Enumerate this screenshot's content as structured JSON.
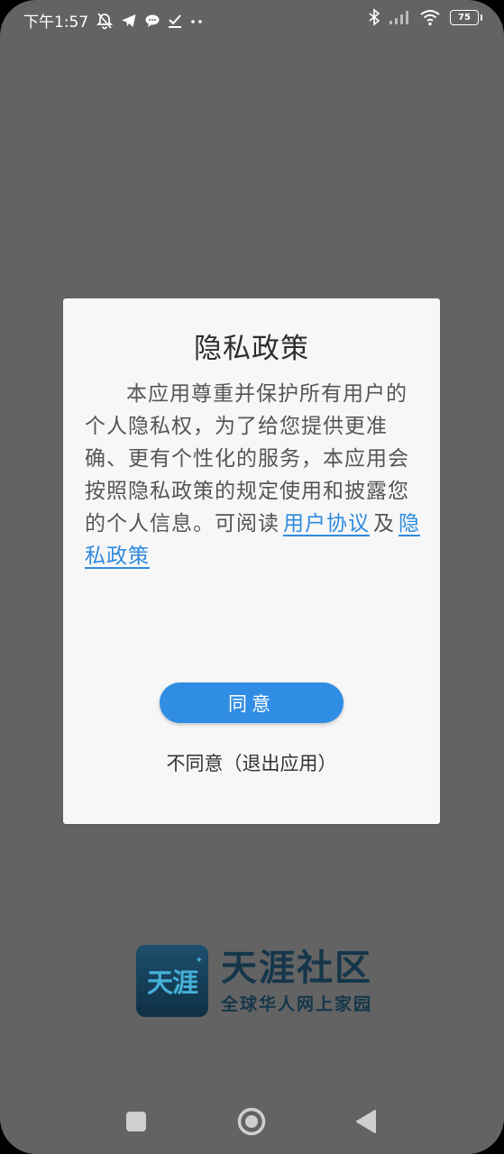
{
  "status_bar": {
    "time": "下午1:57",
    "battery_level": "75"
  },
  "dialog": {
    "title": "隐私政策",
    "body_text": "本应用尊重并保护所有用户的个人隐私权，为了给您提供更准确、更有个性化的服务，本应用会按照隐私政策的规定使用和披露您的个人信息。可阅读",
    "link_user_agreement": "用户协议",
    "conjunction": "及",
    "link_privacy_policy": "隐私政策",
    "agree_label": "同意",
    "disagree_label": "不同意（退出应用）"
  },
  "brand": {
    "logo_text": "天涯",
    "name": "天涯社区",
    "slogan": "全球华人网上家园"
  },
  "colors": {
    "overlay": "#636363",
    "dialog_bg": "#f7f7f7",
    "accent": "#2f8de4",
    "link": "#2e8adf",
    "brand_dark": "#15364a"
  },
  "icons": {
    "status_left": [
      "mute-notification-icon",
      "telegram-icon",
      "chat-bubble-icon",
      "download-check-icon",
      "more-dots-icon"
    ],
    "status_right": [
      "bluetooth-icon",
      "signal-icon",
      "wifi-icon",
      "battery-icon"
    ],
    "nav": [
      "recents-square-icon",
      "home-circle-icon",
      "back-triangle-icon"
    ]
  }
}
